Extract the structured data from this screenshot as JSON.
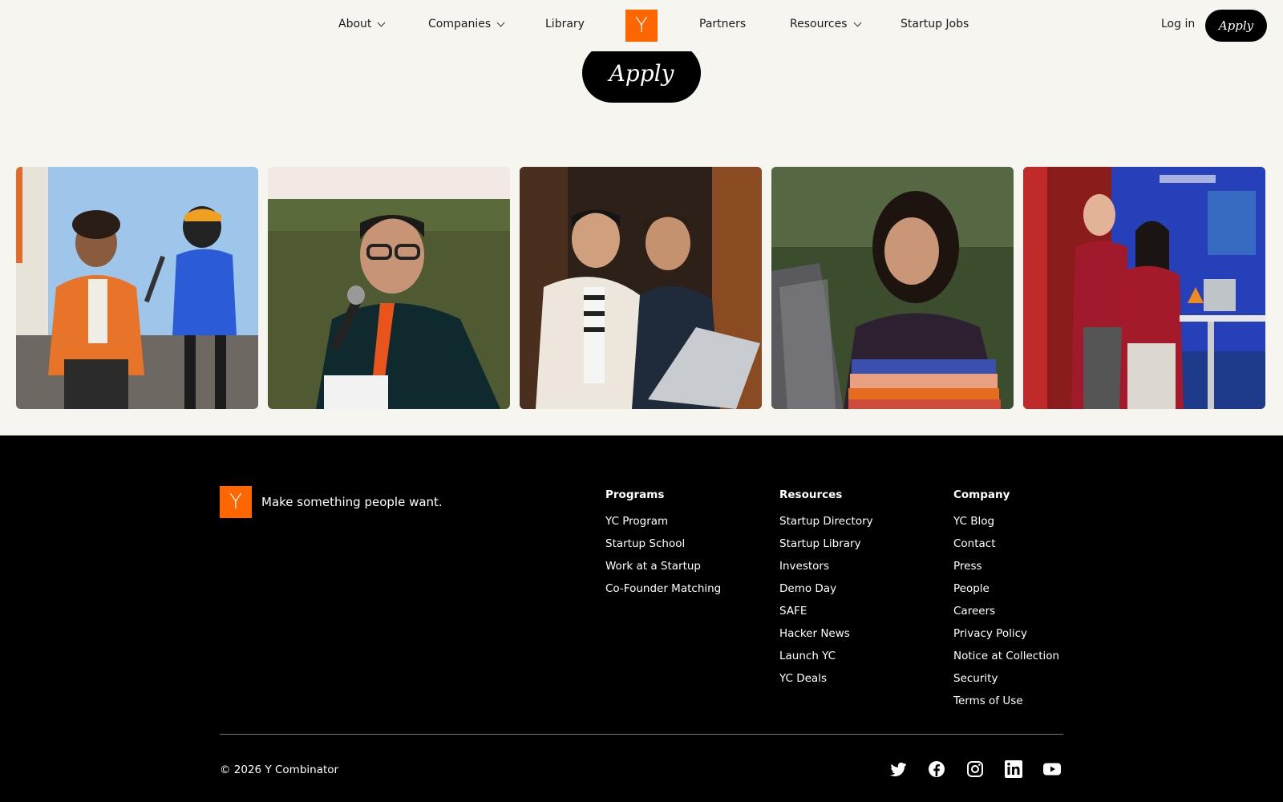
{
  "nav": {
    "items": [
      {
        "label": "About",
        "dropdown": true
      },
      {
        "label": "Companies",
        "dropdown": true
      },
      {
        "label": "Library",
        "dropdown": false
      },
      {
        "label": "Partners",
        "dropdown": false
      },
      {
        "label": "Resources",
        "dropdown": true
      },
      {
        "label": "Startup Jobs",
        "dropdown": false
      }
    ],
    "logo": "Y",
    "login": "Log in",
    "apply": "Apply"
  },
  "hero": {
    "apply": "Apply"
  },
  "colors": {
    "brand": "#ff6600",
    "background": "#f6f5ef",
    "footer": "#000000"
  },
  "footer": {
    "logo": "Y",
    "tagline": "Make something people want.",
    "columns": [
      {
        "title": "Programs",
        "links": [
          "YC Program",
          "Startup School",
          "Work at a Startup",
          "Co-Founder Matching"
        ]
      },
      {
        "title": "Resources",
        "links": [
          "Startup Directory",
          "Startup Library",
          "Investors",
          "Demo Day",
          "SAFE",
          "Hacker News",
          "Launch YC",
          "YC Deals"
        ]
      },
      {
        "title": "Company",
        "links": [
          "YC Blog",
          "Contact",
          "Press",
          "People",
          "Careers",
          "Privacy Policy",
          "Notice at Collection",
          "Security",
          "Terms of Use"
        ]
      }
    ],
    "copyright": "© 2026 Y Combinator",
    "socials": [
      "twitter-icon",
      "facebook-icon",
      "instagram-icon",
      "linkedin-icon",
      "youtube-icon"
    ]
  }
}
